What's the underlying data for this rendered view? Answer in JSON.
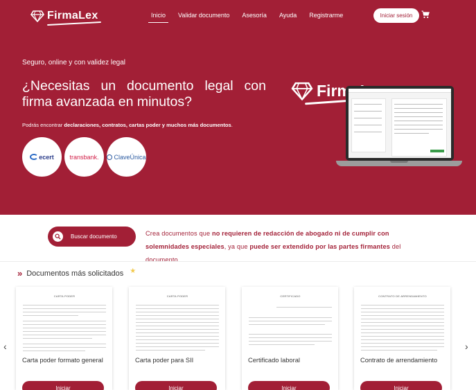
{
  "colors": {
    "brand": "#a21f36",
    "white": "#ffffff"
  },
  "header": {
    "logo_text": "FirmaLex",
    "nav": [
      {
        "label": "Inicio",
        "active": true
      },
      {
        "label": "Validar documento"
      },
      {
        "label": "Asesoría"
      },
      {
        "label": "Ayuda"
      },
      {
        "label": "Registrarme"
      }
    ],
    "login_label": "Iniciar sesión",
    "cart_icon": "cart-icon"
  },
  "hero": {
    "tagline": "Seguro, online y con validez legal",
    "headline": "¿Necesitas un documento legal con firma avanzada en minutos?",
    "subline_prefix": "Podrás encontrar ",
    "subline_bold": "declaraciones, contratos, cartas poder y muchos más documentos",
    "subline_suffix": ".",
    "partners": [
      "ecert",
      "transbank.",
      "ClaveÚnica"
    ],
    "brand_text": "FirmaLex"
  },
  "search": {
    "label": "Buscar documento",
    "promo_1": "Crea documentos que ",
    "promo_b1": "no requieren de redacción de abogado ni de cumplir con solemnidades especiales",
    "promo_2": ", ya que ",
    "promo_b2": "puede ser extendido por las partes firmantes",
    "promo_3": " del documento"
  },
  "documents": {
    "title": "Documentos más solicitados",
    "button_label": "Iniciar",
    "items": [
      {
        "name": "Carta poder formato general",
        "doc_title": "CARTA PODER"
      },
      {
        "name": "Carta poder para SII",
        "doc_title": "CARTA PODER"
      },
      {
        "name": "Certificado laboral",
        "doc_title": "CERTIFICADO"
      },
      {
        "name": "Contrato de arrendamiento",
        "doc_title": "CONTRATO DE ARRENDAMIENTO"
      }
    ]
  }
}
